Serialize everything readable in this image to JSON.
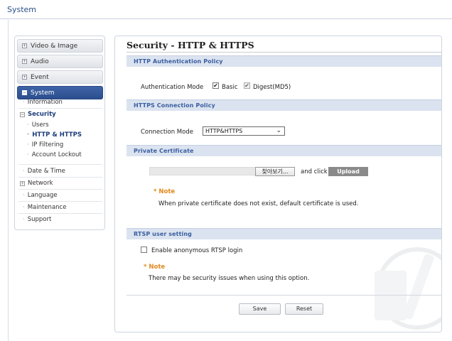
{
  "app": {
    "title": "System"
  },
  "sidebar": {
    "tabs": [
      {
        "label": "Video & Image",
        "active": false
      },
      {
        "label": "Audio",
        "active": false
      },
      {
        "label": "Event",
        "active": false
      },
      {
        "label": "System",
        "active": true
      }
    ],
    "items": [
      {
        "label": "Information"
      },
      {
        "label": "Security"
      },
      {
        "label": "Users"
      },
      {
        "label": "HTTP & HTTPS"
      },
      {
        "label": "IP Filtering"
      },
      {
        "label": "Account Lockout"
      },
      {
        "label": "Date & Time"
      },
      {
        "label": "Network"
      },
      {
        "label": "Language"
      },
      {
        "label": "Maintenance"
      },
      {
        "label": "Support"
      }
    ]
  },
  "page": {
    "title": "Security - HTTP & HTTPS",
    "sections": {
      "auth": {
        "header": "HTTP Authentication Policy",
        "mode_label": "Authentication Mode",
        "basic_label": "Basic",
        "basic_checked": true,
        "digest_label": "Digest(MD5)",
        "digest_checked": true
      },
      "https": {
        "header": "HTTPS Connection Policy",
        "mode_label": "Connection Mode",
        "mode_value": "HTTP&HTTPS"
      },
      "cert": {
        "header": "Private Certificate",
        "browse_label": "찾아보기...",
        "and_click": "and click",
        "upload_label": "Upload",
        "note_title": "* Note",
        "note_text": "When private certificate does not exist, default certificate is used."
      },
      "rtsp": {
        "header": "RTSP user setting",
        "anon_label": "Enable anonymous RTSP login",
        "anon_checked": false,
        "note_title": "* Note",
        "note_text": "There may be security issues when using this option."
      }
    },
    "buttons": {
      "save": "Save",
      "reset": "Reset"
    }
  },
  "icons": {
    "check": "✔",
    "plus": "+",
    "minus": "−",
    "chevron": "⌄",
    "bullet": "·"
  },
  "colors": {
    "accent": "#2c4e8d",
    "section_bg": "#dbe3f0",
    "section_text": "#3a5ea0",
    "note": "#e08a1e"
  }
}
